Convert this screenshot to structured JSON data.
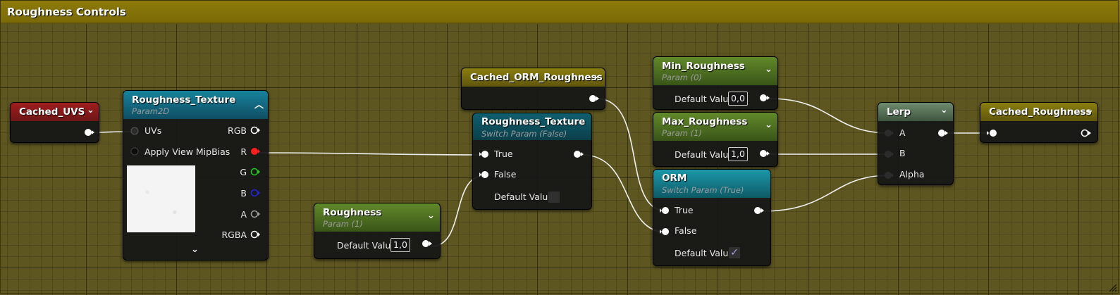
{
  "comment": {
    "title": "Roughness Controls"
  },
  "colors": {
    "comment_header": "#8c7a0a",
    "wire": "#f0f0f0",
    "red_pin": "#ff1e1e",
    "green_pin": "#23c623",
    "blue_pin": "#2323e0",
    "check": "#b19ff0"
  },
  "nodes": {
    "cached_uvs": {
      "title": "Cached_UVS",
      "icon": "chevron-down-icon"
    },
    "roughness_texture_sample": {
      "title": "Roughness_Texture",
      "subtitle": "Param2D",
      "inputs": [
        "UVs",
        "Apply View MipBias"
      ],
      "outputs": [
        "RGB",
        "R",
        "G",
        "B",
        "A",
        "RGBA"
      ],
      "icon": "chevron-up-icon",
      "expand_icon": "chevron-down-icon"
    },
    "roughness_param": {
      "title": "Roughness",
      "subtitle": "Param (1)",
      "default_label": "Default Value",
      "default_value": "1,0"
    },
    "cached_orm_roughness": {
      "title": "Cached_ORM_Roughness"
    },
    "roughness_texture_switch": {
      "title": "Roughness_Texture",
      "subtitle": "Switch Param (False)",
      "true_label": "True",
      "false_label": "False",
      "default_label": "Default Value",
      "default_checked": false
    },
    "min_roughness": {
      "title": "Min_Roughness",
      "subtitle": "Param (0)",
      "default_label": "Default Value",
      "default_value": "0,0"
    },
    "max_roughness": {
      "title": "Max_Roughness",
      "subtitle": "Param (1)",
      "default_label": "Default Value",
      "default_value": "1,0"
    },
    "orm": {
      "title": "ORM",
      "subtitle": "Switch Param (True)",
      "true_label": "True",
      "false_label": "False",
      "default_label": "Default Value",
      "default_checked": true
    },
    "lerp": {
      "title": "Lerp",
      "inputs": [
        "A",
        "B",
        "Alpha"
      ]
    },
    "cached_roughness": {
      "title": "Cached_Roughness"
    }
  }
}
